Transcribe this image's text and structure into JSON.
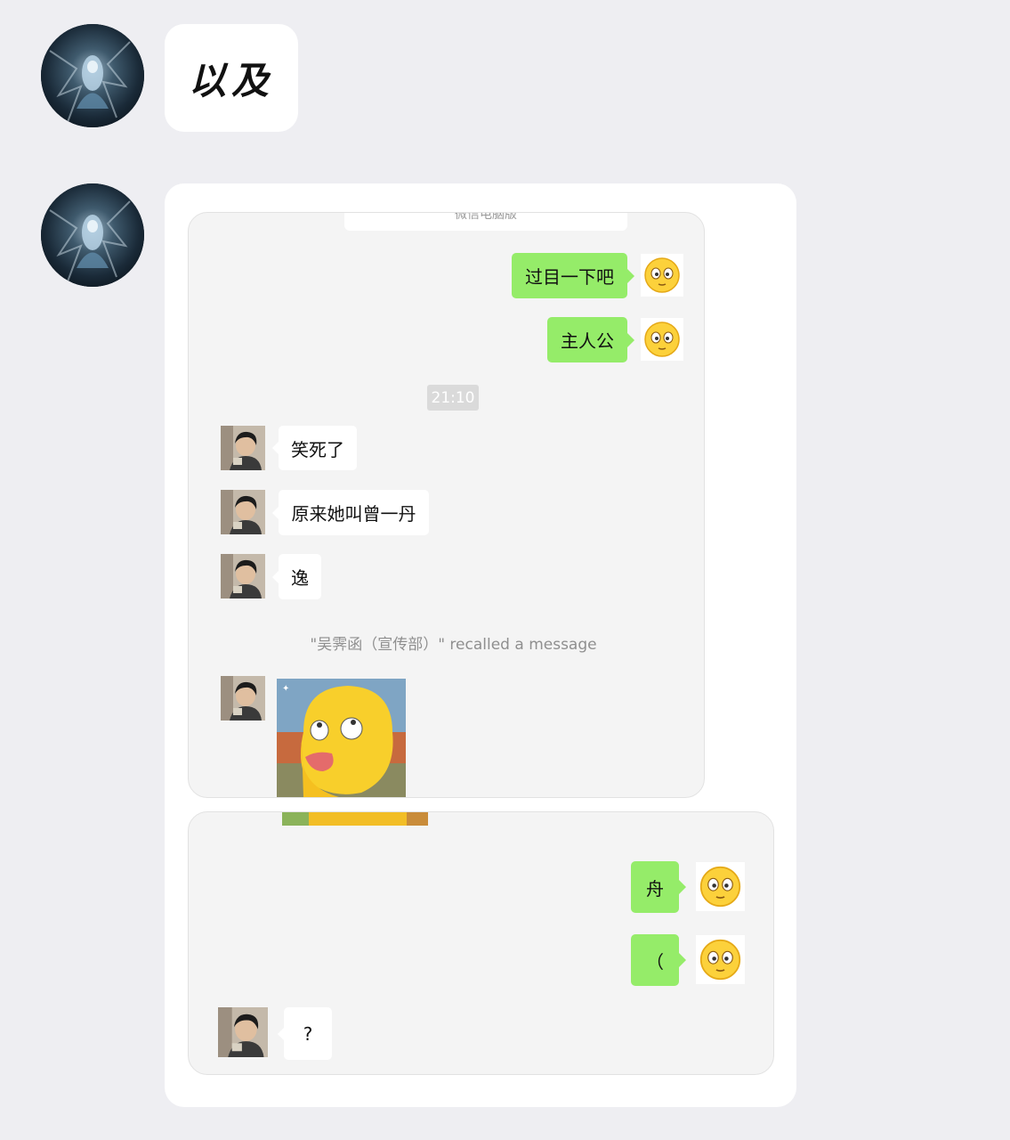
{
  "post1": {
    "text": "以及"
  },
  "panel_top": {
    "header_chip": "微信电脑版",
    "messages": [
      {
        "side": "right",
        "text": "过目一下吧"
      },
      {
        "side": "right",
        "text": "主人公"
      }
    ],
    "timestamp": "21:10",
    "incoming": [
      {
        "text": "笑死了"
      },
      {
        "text": "原来她叫曾一丹"
      },
      {
        "text": "逸"
      }
    ],
    "system_notice": "\"吴霁函（宣传部）\" recalled a message"
  },
  "panel_bottom": {
    "messages": [
      {
        "side": "right",
        "text": "舟"
      },
      {
        "side": "right",
        "text": "（"
      },
      {
        "side": "left",
        "text": "?"
      }
    ]
  },
  "icons": {
    "outer_avatar": "anime-avatar",
    "self_avatar": "flushed-face-emoji-icon",
    "friend_avatar": "person-photo-avatar",
    "sticker": "yellow-duck-sticker"
  },
  "colors": {
    "background": "#eeeef2",
    "outgoing_bubble": "#95ec69",
    "incoming_bubble": "#ffffff",
    "panel": "#f4f4f4"
  }
}
